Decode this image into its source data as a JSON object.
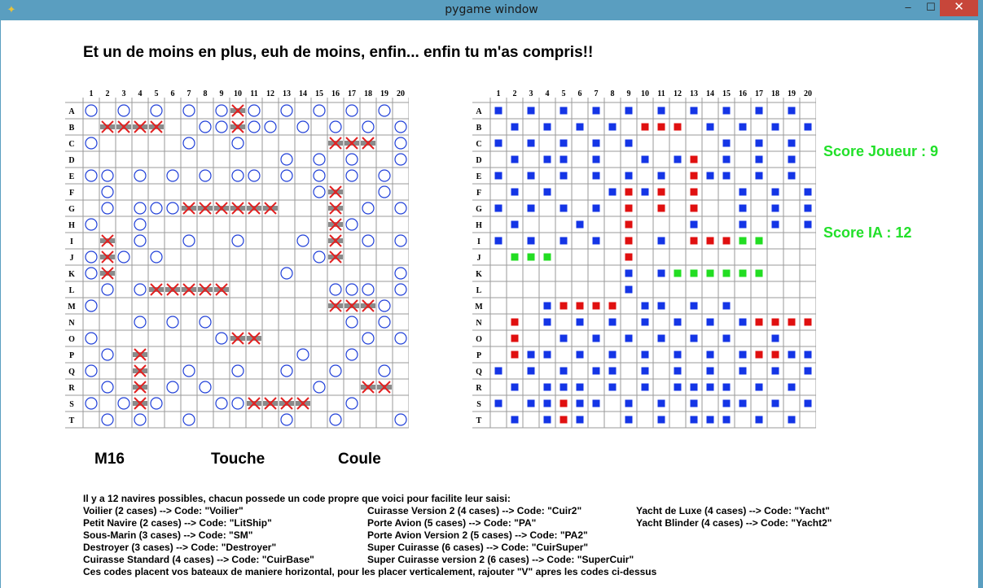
{
  "window": {
    "title": "pygame window",
    "minimize_label": "–",
    "maximize_label": "☐",
    "close_label": "✕"
  },
  "message": "Et un de moins en plus, euh de moins, enfin... enfin tu m'as compris!!",
  "columns": [
    "1",
    "2",
    "3",
    "4",
    "5",
    "6",
    "7",
    "8",
    "9",
    "10",
    "11",
    "12",
    "13",
    "14",
    "15",
    "16",
    "17",
    "18",
    "19",
    "20"
  ],
  "rows": [
    "A",
    "B",
    "C",
    "D",
    "E",
    "F",
    "G",
    "H",
    "I",
    "J",
    "K",
    "L",
    "M",
    "N",
    "O",
    "P",
    "Q",
    "R",
    "S",
    "T"
  ],
  "legend_keys": {
    "o": "miss-ring",
    "x": "hit-cross",
    "s": "ship-hit",
    "b": "shot-miss",
    "r": "shot-hit",
    "g": "ship-position"
  },
  "colors": {
    "miss_ring": "#1f3fd8",
    "hit_cross": "#e22020",
    "ship": "#8a8a8a",
    "blue_mark": "#1435e6",
    "red_mark": "#e01010",
    "green_mark": "#22dd22",
    "score": "#22e02a"
  },
  "player_board": {
    "label": "player-board",
    "cells": [
      [
        "o",
        ".",
        "o",
        ".",
        "o",
        ".",
        "o",
        ".",
        "o",
        "s",
        "o",
        ".",
        "o",
        ".",
        "o",
        ".",
        "o",
        ".",
        "o",
        "."
      ],
      [
        ".",
        "s",
        "s",
        "s",
        "s",
        ".",
        ".",
        "o",
        "o",
        "s",
        "o",
        "o",
        ".",
        "o",
        ".",
        "o",
        ".",
        "o",
        ".",
        "o"
      ],
      [
        "o",
        ".",
        ".",
        ".",
        ".",
        ".",
        "o",
        ".",
        ".",
        "o",
        ".",
        ".",
        ".",
        ".",
        ".",
        "s",
        "s",
        "s",
        ".",
        "o"
      ],
      [
        ".",
        ".",
        ".",
        ".",
        ".",
        ".",
        ".",
        ".",
        ".",
        ".",
        ".",
        ".",
        "o",
        ".",
        "o",
        ".",
        "o",
        ".",
        ".",
        "o"
      ],
      [
        "o",
        "o",
        ".",
        "o",
        ".",
        "o",
        ".",
        "o",
        ".",
        "o",
        "o",
        ".",
        "o",
        ".",
        "o",
        ".",
        "o",
        ".",
        "o",
        "."
      ],
      [
        ".",
        "o",
        ".",
        ".",
        ".",
        ".",
        ".",
        ".",
        ".",
        ".",
        ".",
        ".",
        ".",
        ".",
        "o",
        "s",
        ".",
        ".",
        "o",
        "."
      ],
      [
        ".",
        "o",
        ".",
        "o",
        "o",
        "o",
        "s",
        "s",
        "s",
        "s",
        "s",
        "s",
        ".",
        ".",
        ".",
        "s",
        ".",
        "o",
        ".",
        "o"
      ],
      [
        "o",
        ".",
        ".",
        "o",
        ".",
        ".",
        ".",
        ".",
        ".",
        ".",
        ".",
        ".",
        ".",
        ".",
        ".",
        "s",
        "o",
        ".",
        ".",
        "."
      ],
      [
        ".",
        "s",
        ".",
        "o",
        ".",
        ".",
        "o",
        ".",
        ".",
        "o",
        ".",
        ".",
        ".",
        "o",
        ".",
        "s",
        ".",
        "o",
        ".",
        "o"
      ],
      [
        "o",
        "s",
        "o",
        ".",
        "o",
        ".",
        ".",
        ".",
        ".",
        ".",
        ".",
        ".",
        ".",
        ".",
        "o",
        "s",
        ".",
        ".",
        ".",
        "."
      ],
      [
        "o",
        "s",
        ".",
        ".",
        ".",
        ".",
        ".",
        ".",
        ".",
        ".",
        ".",
        ".",
        "o",
        ".",
        ".",
        ".",
        ".",
        ".",
        ".",
        "o"
      ],
      [
        ".",
        "o",
        ".",
        "o",
        "s",
        "s",
        "s",
        "s",
        "s",
        ".",
        ".",
        ".",
        ".",
        ".",
        ".",
        "o",
        "o",
        "o",
        ".",
        "o"
      ],
      [
        "o",
        ".",
        ".",
        ".",
        ".",
        ".",
        ".",
        ".",
        ".",
        ".",
        ".",
        ".",
        ".",
        ".",
        ".",
        "s",
        "s",
        "s",
        "o",
        "."
      ],
      [
        ".",
        ".",
        ".",
        "o",
        ".",
        "o",
        ".",
        "o",
        ".",
        ".",
        ".",
        ".",
        ".",
        ".",
        ".",
        ".",
        "o",
        ".",
        "o",
        "."
      ],
      [
        "o",
        ".",
        ".",
        ".",
        ".",
        ".",
        ".",
        ".",
        "o",
        "s",
        "s",
        ".",
        ".",
        ".",
        ".",
        ".",
        ".",
        "o",
        ".",
        "o"
      ],
      [
        ".",
        "o",
        ".",
        "s",
        ".",
        ".",
        ".",
        ".",
        ".",
        ".",
        ".",
        ".",
        ".",
        "o",
        ".",
        ".",
        "o",
        ".",
        ".",
        "."
      ],
      [
        "o",
        ".",
        ".",
        "s",
        ".",
        ".",
        "o",
        ".",
        ".",
        "o",
        ".",
        ".",
        "o",
        ".",
        ".",
        "o",
        ".",
        ".",
        "o",
        "."
      ],
      [
        ".",
        "o",
        ".",
        "s",
        ".",
        "o",
        ".",
        "o",
        ".",
        ".",
        ".",
        ".",
        ".",
        ".",
        "o",
        ".",
        ".",
        "s",
        "s",
        "."
      ],
      [
        "o",
        ".",
        "o",
        "s",
        "o",
        ".",
        ".",
        ".",
        "o",
        "o",
        "s",
        "s",
        "s",
        "s",
        ".",
        ".",
        "o",
        ".",
        ".",
        "."
      ],
      [
        ".",
        "o",
        ".",
        "o",
        ".",
        ".",
        "o",
        ".",
        ".",
        ".",
        ".",
        ".",
        "o",
        ".",
        ".",
        "o",
        ".",
        ".",
        ".",
        "o"
      ]
    ]
  },
  "ai_board": {
    "label": "ai-board",
    "cells": [
      [
        "b",
        ".",
        "b",
        ".",
        "b",
        ".",
        "b",
        ".",
        "b",
        ".",
        "b",
        ".",
        "b",
        ".",
        "b",
        ".",
        "b",
        ".",
        "b",
        "."
      ],
      [
        ".",
        "b",
        ".",
        "b",
        ".",
        "b",
        ".",
        "b",
        ".",
        "r",
        "r",
        "r",
        ".",
        "b",
        ".",
        "b",
        ".",
        "b",
        ".",
        "b"
      ],
      [
        "b",
        ".",
        "b",
        ".",
        "b",
        ".",
        "b",
        ".",
        "b",
        ".",
        ".",
        ".",
        ".",
        ".",
        "b",
        ".",
        "b",
        ".",
        "b",
        "."
      ],
      [
        ".",
        "b",
        ".",
        "b",
        "b",
        ".",
        "b",
        ".",
        ".",
        "b",
        ".",
        "b",
        "r",
        ".",
        "b",
        ".",
        "b",
        ".",
        "b",
        "."
      ],
      [
        "b",
        ".",
        "b",
        ".",
        "b",
        ".",
        "b",
        ".",
        "b",
        ".",
        "b",
        ".",
        "r",
        "b",
        "b",
        ".",
        "b",
        ".",
        "b",
        "."
      ],
      [
        ".",
        "b",
        ".",
        "b",
        ".",
        ".",
        ".",
        "b",
        "r",
        "b",
        "r",
        ".",
        "r",
        ".",
        ".",
        "b",
        ".",
        "b",
        ".",
        "b"
      ],
      [
        "b",
        ".",
        "b",
        ".",
        "b",
        ".",
        "b",
        ".",
        "r",
        ".",
        "r",
        ".",
        "r",
        ".",
        ".",
        "b",
        ".",
        "b",
        ".",
        "b"
      ],
      [
        ".",
        "b",
        ".",
        ".",
        ".",
        "b",
        ".",
        ".",
        "r",
        ".",
        ".",
        ".",
        "b",
        ".",
        ".",
        "b",
        ".",
        "b",
        ".",
        "b"
      ],
      [
        "b",
        ".",
        "b",
        ".",
        "b",
        ".",
        "b",
        ".",
        "r",
        ".",
        "b",
        ".",
        "r",
        "r",
        "r",
        "g",
        "g",
        ".",
        ".",
        "."
      ],
      [
        ".",
        "g",
        "g",
        "g",
        ".",
        ".",
        ".",
        ".",
        "r",
        ".",
        ".",
        ".",
        ".",
        ".",
        ".",
        ".",
        ".",
        ".",
        ".",
        "."
      ],
      [
        ".",
        ".",
        ".",
        ".",
        ".",
        ".",
        ".",
        ".",
        "b",
        ".",
        "b",
        "g",
        "g",
        "g",
        "g",
        "g",
        "g",
        ".",
        ".",
        "."
      ],
      [
        ".",
        ".",
        ".",
        ".",
        ".",
        ".",
        ".",
        ".",
        "b",
        ".",
        ".",
        ".",
        ".",
        ".",
        ".",
        ".",
        ".",
        ".",
        ".",
        "."
      ],
      [
        ".",
        ".",
        ".",
        "b",
        "r",
        "r",
        "r",
        "r",
        ".",
        "b",
        "b",
        ".",
        "b",
        ".",
        "b",
        ".",
        ".",
        ".",
        ".",
        "."
      ],
      [
        ".",
        "r",
        ".",
        "b",
        ".",
        "b",
        ".",
        "b",
        ".",
        "b",
        ".",
        "b",
        ".",
        "b",
        ".",
        "b",
        "r",
        "r",
        "r",
        "r"
      ],
      [
        ".",
        "r",
        ".",
        ".",
        "b",
        ".",
        "b",
        ".",
        "b",
        ".",
        "b",
        ".",
        "b",
        ".",
        "b",
        ".",
        ".",
        "b",
        ".",
        "."
      ],
      [
        ".",
        "r",
        "b",
        "b",
        ".",
        "b",
        ".",
        "b",
        ".",
        "b",
        ".",
        "b",
        ".",
        "b",
        ".",
        "b",
        "r",
        "r",
        "b",
        "b"
      ],
      [
        "b",
        ".",
        "b",
        ".",
        "b",
        ".",
        "b",
        "b",
        ".",
        "b",
        ".",
        "b",
        ".",
        "b",
        ".",
        "b",
        ".",
        "b",
        ".",
        "b"
      ],
      [
        ".",
        "b",
        ".",
        "b",
        "b",
        "b",
        ".",
        "b",
        ".",
        "b",
        ".",
        "b",
        "b",
        "b",
        "b",
        ".",
        "b",
        ".",
        "b",
        "."
      ],
      [
        "b",
        ".",
        "b",
        "b",
        "r",
        "b",
        "b",
        ".",
        "b",
        ".",
        "b",
        ".",
        "b",
        ".",
        "b",
        "b",
        ".",
        "b",
        ".",
        "b"
      ],
      [
        ".",
        "b",
        ".",
        "b",
        "r",
        "b",
        ".",
        ".",
        "b",
        ".",
        "b",
        ".",
        "b",
        "b",
        "b",
        ".",
        "b",
        ".",
        "b",
        "."
      ]
    ]
  },
  "scores": {
    "player": "Score Joueur :  9",
    "ai": "Score IA : 12"
  },
  "status": {
    "coordinate": "M16",
    "hit": "Touche",
    "sunk": "Coule"
  },
  "instructions": {
    "intro": "Il y a 12 navires possibles, chacun possede un code propre que voici pour facilite leur saisi:",
    "col1": [
      "Voilier (2 cases) --> Code: \"Voilier\"",
      "Petit Navire (2 cases) --> Code: \"LitShip\"",
      "Sous-Marin (3 cases) --> Code: \"SM\"",
      "Destroyer (3 cases) --> Code: \"Destroyer\"",
      "Cuirasse Standard (4 cases) --> Code: \"CuirBase\""
    ],
    "col2": [
      "Cuirasse Version 2 (4 cases) --> Code: \"Cuir2\"",
      "Porte Avion (5 cases) --> Code: \"PA\"",
      "Porte Avion Version 2 (5 cases) --> Code: \"PA2\"",
      "Super Cuirasse (6 cases) --> Code: \"CuirSuper\"",
      "Super Cuirasse version 2 (6 cases) --> Code: \"SuperCuir\""
    ],
    "col3": [
      "Yacht de Luxe (4 cases) --> Code: \"Yacht\"",
      "Yacht Blinder (4 cases) --> Code: \"Yacht2\""
    ],
    "footer": "Ces codes placent vos bateaux de maniere horizontal, pour les placer verticalement, rajouter \"V\" apres les codes ci-dessus"
  }
}
